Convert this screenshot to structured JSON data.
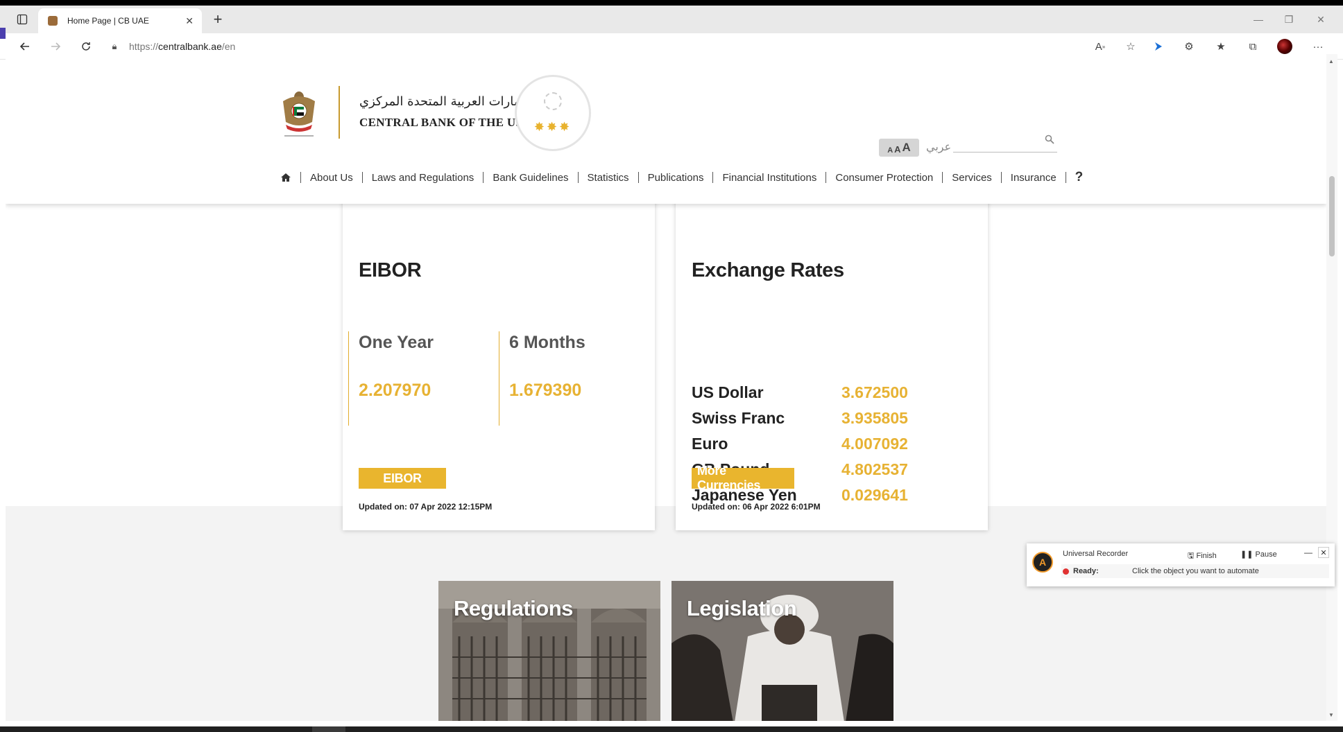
{
  "browser": {
    "tab_title": "Home Page | CB UAE",
    "url_prefix": "https://",
    "url_host": "centralbank.ae",
    "url_path": "/en"
  },
  "header": {
    "brand_arabic": "مصرف الإمارات العربية المتحدة المركزي",
    "brand_english": "CENTRAL BANK OF THE U.A.E.",
    "font_size_label": "AAA",
    "language_toggle": "عربي",
    "search_placeholder": ""
  },
  "nav": {
    "items": [
      "About Us",
      "Laws and Regulations",
      "Bank Guidelines",
      "Statistics",
      "Publications",
      "Financial Institutions",
      "Consumer Protection",
      "Services",
      "Insurance"
    ],
    "help": "?"
  },
  "eibor": {
    "title": "EIBOR",
    "col1_label": "One Year",
    "col1_value": "2.207970",
    "col2_label": "6 Months",
    "col2_value": "1.679390",
    "button": "EIBOR",
    "updated": "Updated on: 07 Apr 2022 12:15PM"
  },
  "exchange": {
    "title": "Exchange Rates",
    "rates": [
      {
        "currency": "US Dollar",
        "value": "3.672500"
      },
      {
        "currency": "Swiss Franc",
        "value": "3.935805"
      },
      {
        "currency": "Euro",
        "value": "4.007092"
      },
      {
        "currency": "GB Pound",
        "value": "4.802537"
      },
      {
        "currency": "Japanese Yen",
        "value": "0.029641"
      }
    ],
    "button": "More Currencies",
    "updated": "Updated on: 06 Apr 2022 6:01PM"
  },
  "tiles": {
    "regulations": "Regulations",
    "legislation": "Legislation"
  },
  "recorder": {
    "name": "Universal Recorder",
    "finish": "Finish",
    "pause": "Pause",
    "status": "Ready:",
    "message": "Click the object you want to automate"
  },
  "colors": {
    "gold": "#e9b52e",
    "brand_line": "#c79a2e"
  }
}
